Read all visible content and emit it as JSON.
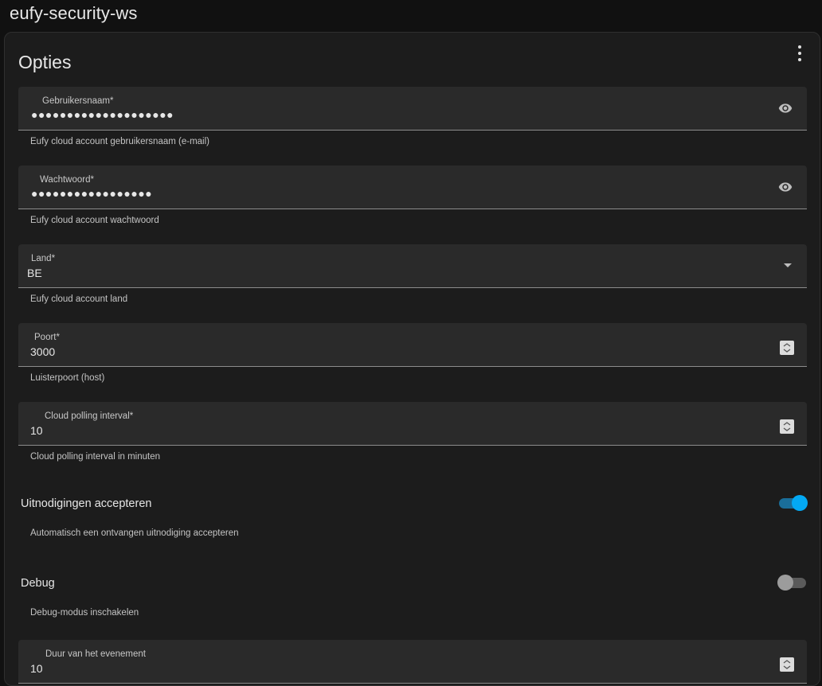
{
  "app": {
    "title": "eufy-security-ws"
  },
  "card": {
    "title": "Opties"
  },
  "fields": {
    "username": {
      "label": "Gebruikersnaam*",
      "value": "●●●●●●●●●●●●●●●●●●●●",
      "helper": "Eufy cloud account gebruikersnaam (e-mail)"
    },
    "password": {
      "label": "Wachtwoord*",
      "value": "●●●●●●●●●●●●●●●●●",
      "helper": "Eufy cloud account wachtwoord"
    },
    "country": {
      "label": "Land*",
      "value": "BE",
      "helper": "Eufy cloud account land"
    },
    "port": {
      "label": "Poort*",
      "value": "3000",
      "helper": "Luisterpoort (host)"
    },
    "polling": {
      "label": "Cloud polling interval*",
      "value": "10",
      "helper": "Cloud polling interval in minuten"
    },
    "event_duration": {
      "label": "Duur van het evenement",
      "value": "10"
    }
  },
  "toggles": {
    "accept_invitations": {
      "label": "Uitnodigingen accepteren",
      "helper": "Automatisch een ontvangen uitnodiging accepteren",
      "on": true
    },
    "debug": {
      "label": "Debug",
      "helper": "Debug-modus inschakelen",
      "on": false
    }
  },
  "colors": {
    "accent": "#03a9f4",
    "background": "#111111",
    "card": "#1c1c1c",
    "field": "#2a2a2a"
  },
  "icons": [
    "more-vert-icon",
    "eye-icon",
    "dropdown-caret-icon",
    "spinner-icon"
  ]
}
